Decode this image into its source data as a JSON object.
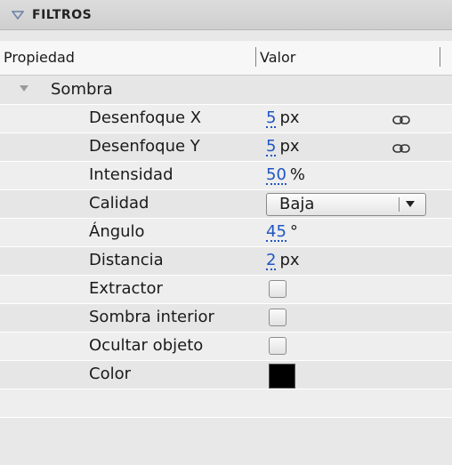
{
  "panel": {
    "title": "FILTROS"
  },
  "columns": {
    "property": "Propiedad",
    "value": "Valor"
  },
  "group": {
    "label": "Sombra"
  },
  "rows": {
    "blur_x": {
      "label": "Desenfoque X",
      "value": "5",
      "unit": "px",
      "icon": "link-icon"
    },
    "blur_y": {
      "label": "Desenfoque Y",
      "value": "5",
      "unit": "px",
      "icon": "link-icon"
    },
    "strength": {
      "label": "Intensidad",
      "value": "50",
      "unit": "%"
    },
    "quality": {
      "label": "Calidad",
      "selected": "Baja"
    },
    "angle": {
      "label": "Ángulo",
      "value": "45",
      "unit": "°"
    },
    "distance": {
      "label": "Distancia",
      "value": "2",
      "unit": "px"
    },
    "knockout": {
      "label": "Extractor",
      "checked": false
    },
    "inner_shadow": {
      "label": "Sombra interior",
      "checked": false
    },
    "hide_object": {
      "label": "Ocultar objeto",
      "checked": false
    },
    "color": {
      "label": "Color",
      "swatch": "#000000"
    }
  },
  "colors": {
    "accent": "#1f56c2",
    "header_bg": "#d5d5d5"
  }
}
